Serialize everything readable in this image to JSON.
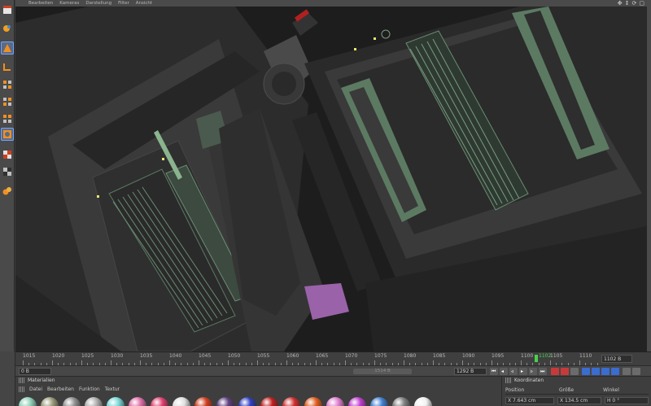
{
  "viewport": {
    "menu": [
      "Bearbeiten",
      "Kameras",
      "Darstellung",
      "Filter",
      "Ansicht"
    ],
    "nav_icons": [
      "move-icon",
      "zoom-icon",
      "rotate-icon",
      "maximize-icon"
    ]
  },
  "toolbar": {
    "icons": [
      "render-view-icon",
      "paint-icon",
      "cone-icon",
      "bend-icon",
      "grid-icon",
      "grid-icon",
      "grid-icon",
      "scene-icon",
      "checker-icon",
      "checker-icon",
      "spheres-icon"
    ]
  },
  "timeline": {
    "ticks": [
      "1015",
      "1020",
      "1025",
      "1030",
      "1035",
      "1040",
      "1045",
      "1050",
      "1055",
      "1060",
      "1065",
      "1070",
      "1075",
      "1080",
      "1085",
      "1090",
      "1095",
      "1100",
      "1105",
      "1110"
    ],
    "current_frame": "1102",
    "frame_field": "1102 B"
  },
  "transport": {
    "start_field": "0 B",
    "scroll_label": "1514 B",
    "end_field": "1292 B"
  },
  "materials": {
    "title": "Materialien",
    "menu": [
      "Datei",
      "Bearbeiten",
      "Funktion",
      "Textur"
    ],
    "swatches": [
      "#8fd0b8",
      "#9a9a7a",
      "#909090",
      "#b0b0b0",
      "#7ad8d8",
      "#e070a8",
      "#e04070",
      "#e0e0e0",
      "#d04020",
      "#604080",
      "#3040c0",
      "#c02020",
      "#d03030",
      "#e06020",
      "#e080d0",
      "#c040d0",
      "#4080d0",
      "#808080",
      "#f0f0f0"
    ]
  },
  "coordinates": {
    "title": "Koordinaten",
    "col_position": "Position",
    "col_size": "Größe",
    "col_angle": "Winkel",
    "x_position": "X  7.643 cm",
    "x_size": "X  134.5 cm",
    "h_angle": "H  0 °"
  }
}
